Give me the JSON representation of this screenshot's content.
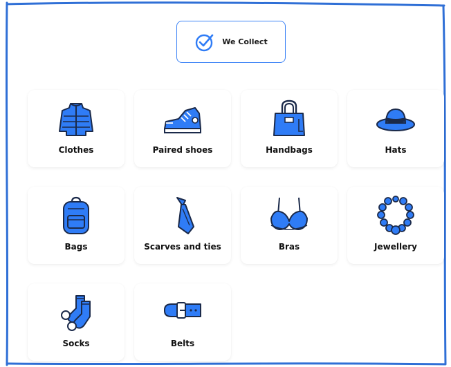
{
  "badge": {
    "label": "We Collect",
    "icon": "check-circle-icon"
  },
  "accent_color": "#2f7cf6",
  "outline_color": "#1b2a4a",
  "items": [
    {
      "label": "Clothes",
      "icon": "puffer-jacket-icon"
    },
    {
      "label": "Paired shoes",
      "icon": "sneaker-icon"
    },
    {
      "label": "Handbags",
      "icon": "handbag-icon"
    },
    {
      "label": "Hats",
      "icon": "hat-icon"
    },
    {
      "label": "Bags",
      "icon": "backpack-icon"
    },
    {
      "label": "Scarves and ties",
      "icon": "tie-icon"
    },
    {
      "label": "Bras",
      "icon": "bra-icon"
    },
    {
      "label": "Jewellery",
      "icon": "necklace-icon"
    },
    {
      "label": "Socks",
      "icon": "socks-icon"
    },
    {
      "label": "Belts",
      "icon": "belt-icon"
    }
  ]
}
